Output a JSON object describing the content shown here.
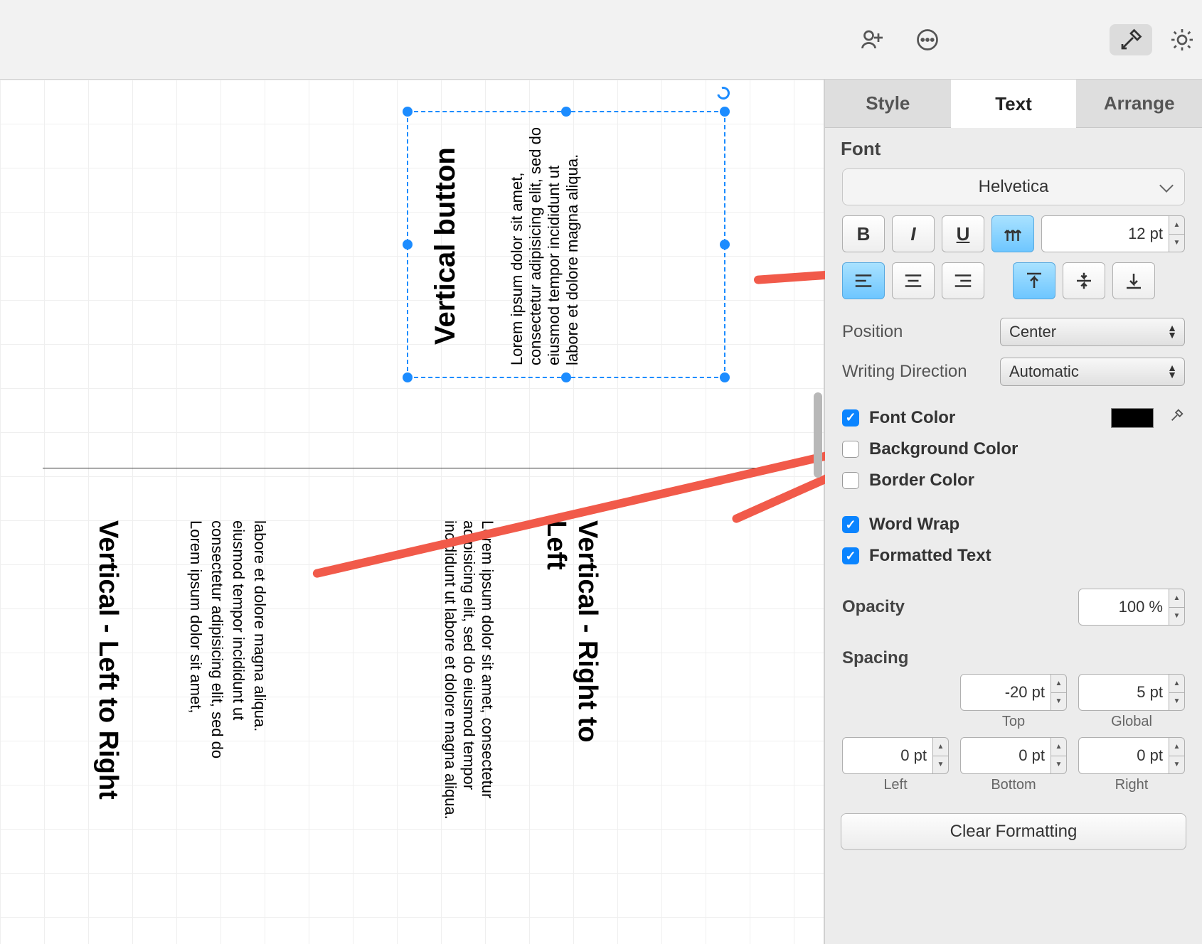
{
  "toolbar": {
    "share_icon": "share",
    "more_icon": "more",
    "style_icon": "wand",
    "appearance_icon": "sun"
  },
  "inspector": {
    "tabs": {
      "style": "Style",
      "text": "Text",
      "arrange": "Arrange",
      "active": "text"
    },
    "font": {
      "section_label": "Font",
      "family": "Helvetica",
      "size": "12 pt",
      "bold": "B",
      "italic": "I",
      "underline": "U"
    },
    "position": {
      "label": "Position",
      "value": "Center"
    },
    "writing_direction": {
      "label": "Writing Direction",
      "value": "Automatic"
    },
    "font_color": {
      "label": "Font Color",
      "checked": true,
      "swatch": "#000000"
    },
    "background_color": {
      "label": "Background Color",
      "checked": false
    },
    "border_color": {
      "label": "Border Color",
      "checked": false
    },
    "word_wrap": {
      "label": "Word Wrap",
      "checked": true
    },
    "formatted_text": {
      "label": "Formatted Text",
      "checked": true
    },
    "opacity": {
      "label": "Opacity",
      "value": "100 %"
    },
    "spacing": {
      "label": "Spacing",
      "top": {
        "value": "-20 pt",
        "label": "Top"
      },
      "global": {
        "value": "5 pt",
        "label": "Global"
      },
      "left": {
        "value": "0 pt",
        "label": "Left"
      },
      "bottom": {
        "value": "0 pt",
        "label": "Bottom"
      },
      "right": {
        "value": "0 pt",
        "label": "Right"
      }
    },
    "clear_formatting": "Clear Formatting"
  },
  "canvas": {
    "selected": {
      "title": "Vertical button",
      "body": "Lorem ipsum dolor sit amet, consectetur adipisicing elit, sed do eiusmod tempor incididunt ut labore et dolore magna aliqua."
    },
    "block_rl": {
      "title": "Vertical - Right to Left",
      "body": "Lorem ipsum dolor sit amet, consectetur adipisicing elit, sed do eiusmod tempor incididunt ut labore et dolore magna aliqua."
    },
    "block_lr": {
      "title": "Vertical - Left to Right",
      "body_line1": "labore et dolore magna aliqua.",
      "body_line2": "eiusmod tempor incididunt ut",
      "body_line3": "consectetur adipisicing elit, sed do",
      "body_line4": "Lorem ipsum dolor sit amet,"
    }
  }
}
